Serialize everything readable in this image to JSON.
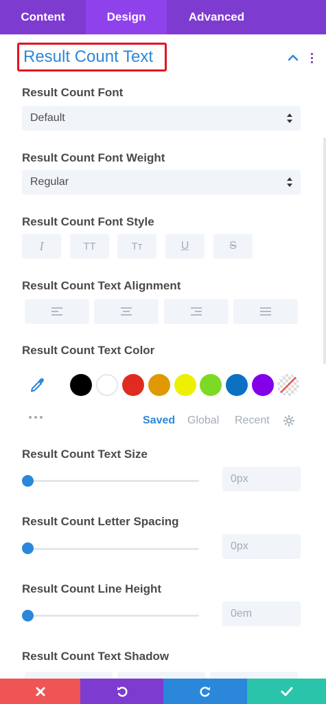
{
  "tabs": {
    "content": "Content",
    "design": "Design",
    "advanced": "Advanced",
    "active": "Design"
  },
  "section": {
    "title": "Result Count Text"
  },
  "font": {
    "label": "Result Count Font",
    "value": "Default"
  },
  "font_weight": {
    "label": "Result Count Font Weight",
    "value": "Regular"
  },
  "font_style": {
    "label": "Result Count Font Style",
    "buttons": [
      "italic",
      "uppercase",
      "capitalize",
      "underline",
      "strikethrough"
    ],
    "glyphs": [
      "I",
      "TT",
      "Tт",
      "U",
      "S"
    ]
  },
  "text_alignment": {
    "label": "Result Count Text Alignment",
    "options": [
      "left",
      "center",
      "right",
      "justify"
    ]
  },
  "text_color": {
    "label": "Result Count Text Color",
    "swatches": [
      "#000000",
      "#ffffff",
      "#e02b20",
      "#e09900",
      "#edf000",
      "#7cda24",
      "#0c71c3",
      "#8300e9",
      "none"
    ],
    "subtabs": {
      "saved": "Saved",
      "global": "Global",
      "recent": "Recent"
    },
    "active_subtab": "Saved"
  },
  "text_size": {
    "label": "Result Count Text Size",
    "value": "0px",
    "level": 0
  },
  "letter_spacing": {
    "label": "Result Count Letter Spacing",
    "value": "0px",
    "level": 0
  },
  "line_height": {
    "label": "Result Count Line Height",
    "value": "0em",
    "level": 0
  },
  "text_shadow": {
    "label": "Result Count Text Shadow"
  },
  "colors": {
    "purple": "#7e3bd0",
    "active_tab": "#8f42ec",
    "accent_blue": "#2b87da",
    "red": "#ef5555",
    "green": "#29c4a9",
    "highlight": "#e0141e"
  },
  "icons": [
    "chevron-up-icon",
    "kebab-menu-icon",
    "eyedropper-icon",
    "more-dots-icon",
    "gear-icon",
    "close-icon",
    "undo-icon",
    "redo-icon",
    "check-icon"
  ]
}
